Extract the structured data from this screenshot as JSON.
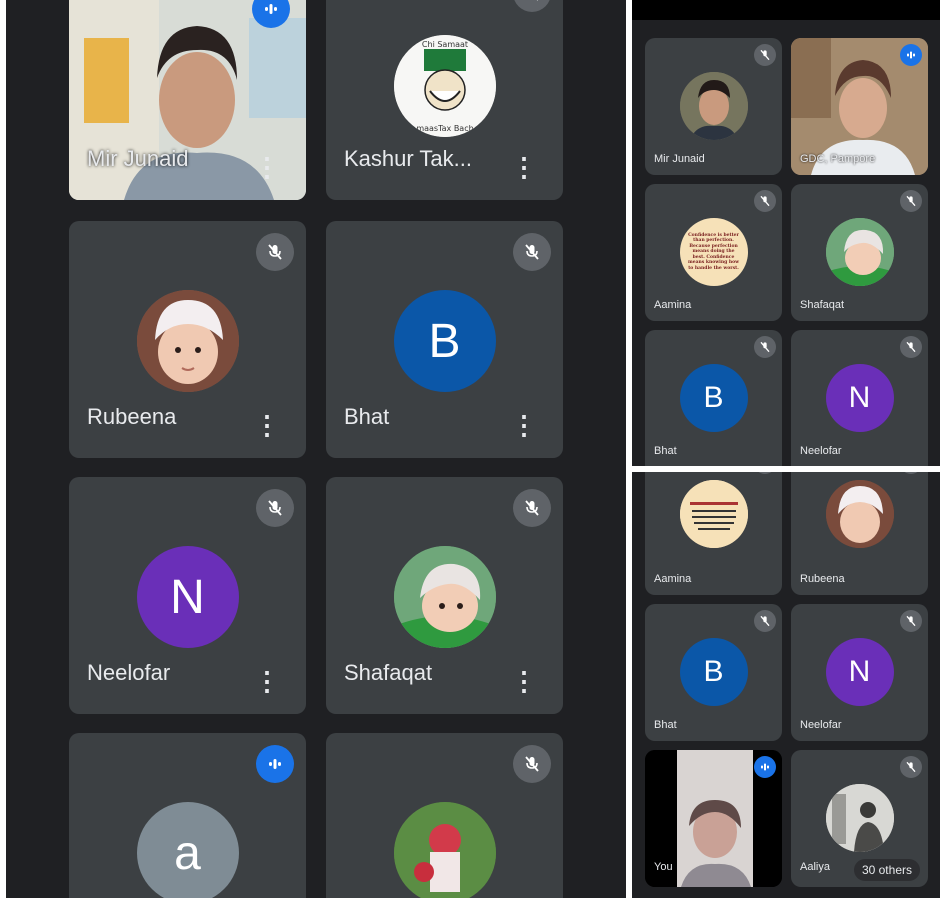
{
  "colors": {
    "tile_bg": "#3c4043",
    "panel_bg": "#1f2023",
    "mic_off": "#5f6368",
    "speaking": "#1a73e8",
    "avatar_blue": "#0b57a8",
    "avatar_purple": "#6a2fb8",
    "avatar_grey": "#7f8c95"
  },
  "left": {
    "tiles": [
      {
        "name": "Mir Junaid",
        "type": "video",
        "mic": "speaking"
      },
      {
        "name": "Kashur Tak...",
        "type": "photo",
        "mic": "muted"
      },
      {
        "name": "Rubeena",
        "type": "photo",
        "mic": "muted"
      },
      {
        "name": "Bhat",
        "type": "letter",
        "letter": "B",
        "mic": "muted"
      },
      {
        "name": "Neelofar",
        "type": "letter",
        "letter": "N",
        "mic": "muted"
      },
      {
        "name": "Shafaqat",
        "type": "photo",
        "mic": "muted"
      },
      {
        "name": "",
        "type": "letter",
        "letter": "a",
        "mic": "speaking"
      },
      {
        "name": "",
        "type": "photo",
        "mic": "muted"
      }
    ]
  },
  "right_top": {
    "tiles": [
      {
        "name": "Mir Junaid",
        "type": "photo",
        "mic": "muted"
      },
      {
        "name": "GDC, Pampore",
        "type": "video",
        "mic": "speaking"
      },
      {
        "name": "Aamina",
        "type": "photo",
        "mic": "muted",
        "quote": "Confidence is better than perfection. Because perfection means doing the best. Confidence means knowing how to handle the worst."
      },
      {
        "name": "Shafaqat",
        "type": "photo",
        "mic": "muted"
      },
      {
        "name": "Bhat",
        "type": "letter",
        "letter": "B",
        "mic": "muted"
      },
      {
        "name": "Neelofar",
        "type": "letter",
        "letter": "N",
        "mic": "muted"
      }
    ]
  },
  "right_bottom": {
    "tiles": [
      {
        "name": "Aamina",
        "type": "photo",
        "mic": "muted"
      },
      {
        "name": "Rubeena",
        "type": "photo",
        "mic": "muted"
      },
      {
        "name": "Bhat",
        "type": "letter",
        "letter": "B",
        "mic": "muted"
      },
      {
        "name": "Neelofar",
        "type": "letter",
        "letter": "N",
        "mic": "muted"
      },
      {
        "name": "You",
        "type": "video",
        "mic": "speaking"
      },
      {
        "name": "Aaliya",
        "type": "photo",
        "mic": "muted"
      }
    ],
    "others_badge": "30 others"
  },
  "icons": {
    "muted": "mic-off-icon",
    "speaking": "audio-level-icon",
    "menu": "more-vert-icon"
  }
}
